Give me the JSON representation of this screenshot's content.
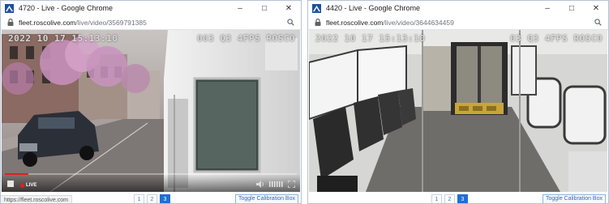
{
  "windows": [
    {
      "title": "4720 - Live - Google Chrome",
      "url_domain": "fleet.roscolive.com",
      "url_path": "/live/video/3569791385",
      "overlay_left": "2022 10 17 15:13:10",
      "overlay_right": "003 Q3 4FPS ROSCO",
      "live_label": "LIVE",
      "progress": 0.08,
      "status_url": "https://fleet.roscolive.com",
      "pages": [
        "1",
        "2",
        "3"
      ],
      "active_page": "3",
      "calibration_label": "Toggle Calibration Box"
    },
    {
      "title": "4420 - Live - Google Chrome",
      "url_domain": "fleet.roscolive.com",
      "url_path": "/live/video/3644634459",
      "overlay_left": "2022 10 17 15:13:10",
      "overlay_right": "03 Q3 4FPS ROSCO",
      "pages": [
        "1",
        "2",
        "3"
      ],
      "active_page": "3",
      "calibration_label": "Toggle Calibration Box"
    }
  ],
  "window_controls": {
    "minimize": "–",
    "maximize": "□",
    "close": "✕"
  },
  "colors": {
    "accent": "#1f6fd6",
    "live_red": "#e02020",
    "link": "#337ab7"
  }
}
